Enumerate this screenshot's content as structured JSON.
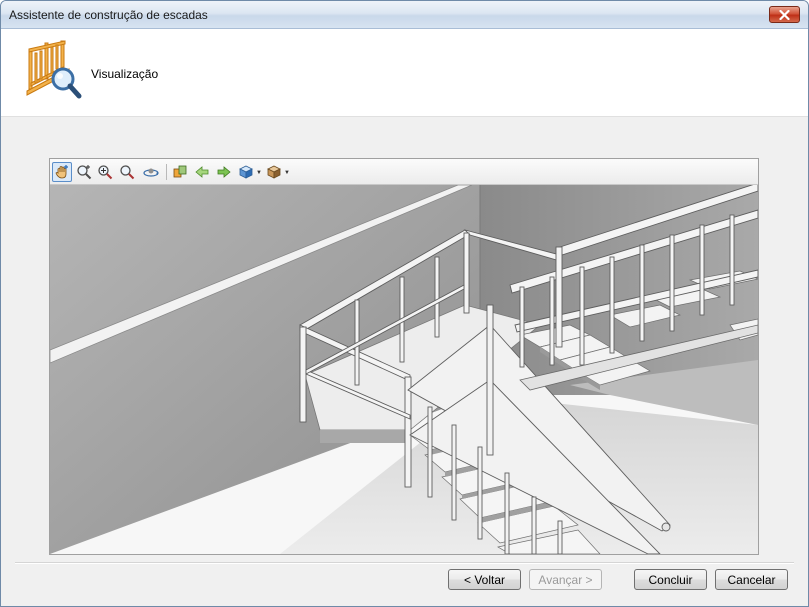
{
  "window": {
    "title": "Assistente de construção de escadas",
    "close_icon": "close-icon"
  },
  "header": {
    "title": "Visualização",
    "icon": "stair-preview-icon"
  },
  "toolbar": {
    "buttons": [
      {
        "name": "pan-tool",
        "icon": "hand-pan-icon",
        "active": true
      },
      {
        "name": "zoom-window",
        "icon": "zoom-window-icon"
      },
      {
        "name": "zoom-in-out",
        "icon": "zoom-dynamic-icon"
      },
      {
        "name": "zoom-extents",
        "icon": "zoom-extents-icon"
      },
      {
        "name": "orbit",
        "icon": "orbit-icon"
      },
      {
        "name": "render-mode",
        "icon": "render-mode-icon"
      },
      {
        "name": "view-previous",
        "icon": "arrow-left-icon"
      },
      {
        "name": "view-next",
        "icon": "arrow-right-icon"
      },
      {
        "name": "view-cube",
        "icon": "view-cube-icon"
      },
      {
        "name": "shading",
        "icon": "shaded-box-icon"
      }
    ]
  },
  "buttons": {
    "back": "< Voltar",
    "next": "Avançar >",
    "finish": "Concluir",
    "cancel": "Cancelar"
  },
  "colors": {
    "accent": "#5b8ec9",
    "stair_orange": "#f0a63a",
    "title_close": "#c73a1f"
  }
}
